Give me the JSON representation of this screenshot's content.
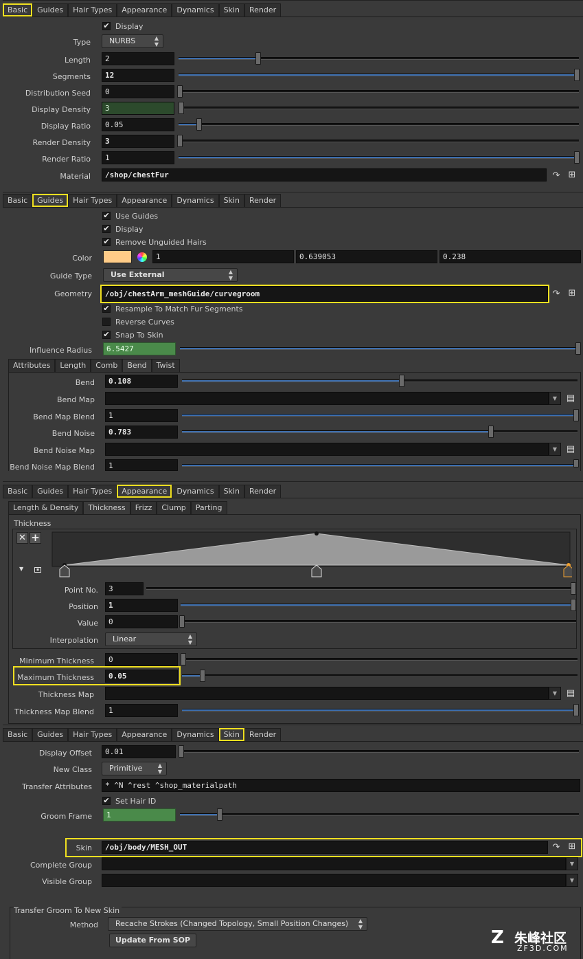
{
  "tabs": [
    "Basic",
    "Guides",
    "Hair Types",
    "Appearance",
    "Dynamics",
    "Skin",
    "Render"
  ],
  "basic": {
    "display_label": "Display",
    "type_label": "Type",
    "type_value": "NURBS",
    "length_label": "Length",
    "length_value": "2",
    "segments_label": "Segments",
    "segments_value": "12",
    "dist_seed_label": "Distribution Seed",
    "dist_seed_value": "0",
    "disp_density_label": "Display Density",
    "disp_density_value": "3",
    "disp_ratio_label": "Display Ratio",
    "disp_ratio_value": "0.05",
    "render_density_label": "Render Density",
    "render_density_value": "3",
    "render_ratio_label": "Render Ratio",
    "render_ratio_value": "1",
    "material_label": "Material",
    "material_value": "/shop/chestFur"
  },
  "guides": {
    "use_guides_label": "Use Guides",
    "display_label": "Display",
    "remove_unguided_label": "Remove Unguided Hairs",
    "color_label": "Color",
    "color_swatch": "#ffcc88",
    "color_r": "1",
    "color_g": "0.639053",
    "color_b": "0.238",
    "guide_type_label": "Guide Type",
    "guide_type_value": "Use External",
    "geometry_label": "Geometry",
    "geometry_value": "/obj/chestArm_meshGuide/curvegroom",
    "resample_label": "Resample To Match Fur Segments",
    "reverse_label": "Reverse Curves",
    "snap_label": "Snap To Skin",
    "influence_label": "Influence Radius",
    "influence_value": "6.5427",
    "subtabs": [
      "Attributes",
      "Length",
      "Comb",
      "Bend",
      "Twist"
    ],
    "bend_label": "Bend",
    "bend_value": "0.108",
    "bend_map_label": "Bend Map",
    "bend_map_blend_label": "Bend Map Blend",
    "bend_map_blend_value": "1",
    "bend_noise_label": "Bend Noise",
    "bend_noise_value": "0.783",
    "bend_noise_map_label": "Bend Noise Map",
    "bend_noise_map_blend_label": "Bend Noise Map Blend",
    "bend_noise_map_blend_value": "1"
  },
  "appearance": {
    "subtabs": [
      "Length & Density",
      "Thickness",
      "Frizz",
      "Clump",
      "Parting"
    ],
    "thickness_header": "Thickness",
    "ramp_points": [
      0,
      1,
      0
    ],
    "point_no_label": "Point No.",
    "point_no_value": "3",
    "position_label": "Position",
    "position_value": "1",
    "value_label": "Value",
    "value_value": "0",
    "interp_label": "Interpolation",
    "interp_value": "Linear",
    "min_thick_label": "Minimum Thickness",
    "min_thick_value": "0",
    "max_thick_label": "Maximum Thickness",
    "max_thick_value": "0.05",
    "thick_map_label": "Thickness Map",
    "thick_map_blend_label": "Thickness Map Blend",
    "thick_map_blend_value": "1"
  },
  "skin": {
    "display_offset_label": "Display Offset",
    "display_offset_value": "0.01",
    "new_class_label": "New Class",
    "new_class_value": "Primitive",
    "transfer_attr_label": "Transfer Attributes",
    "transfer_attr_value": "* ^N ^rest ^shop_materialpath",
    "set_hair_id_label": "Set Hair ID",
    "groom_frame_label": "Groom Frame",
    "groom_frame_value": "1",
    "skin_label": "Skin",
    "skin_value": "/obj/body/MESH_OUT",
    "complete_group_label": "Complete Group",
    "visible_group_label": "Visible Group",
    "transfer_header": "Transfer Groom To New Skin",
    "method_label": "Method",
    "method_value": "Recache Strokes (Changed Topology, Small Position Changes)",
    "update_button": "Update From SOP"
  },
  "watermark": {
    "title": "朱峰社区",
    "sub": "ZF3D.COM"
  }
}
